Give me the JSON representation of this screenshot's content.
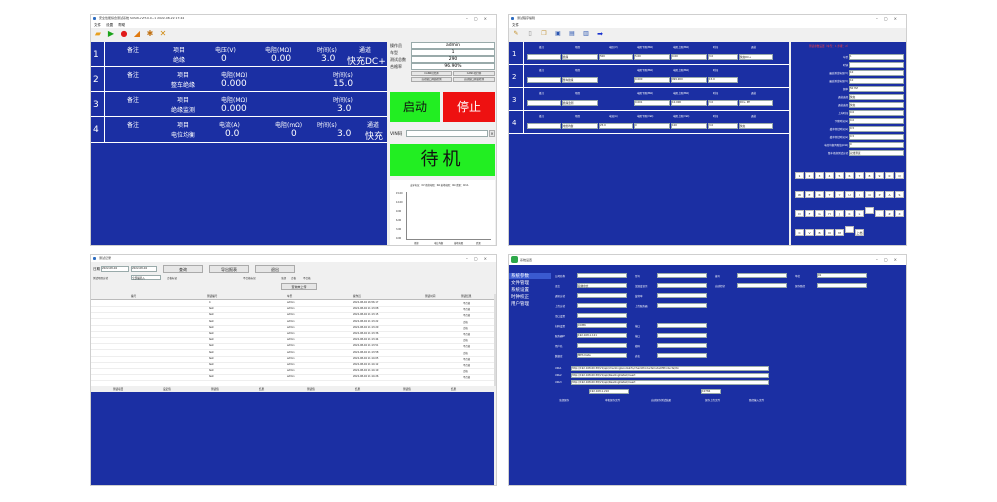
{
  "w1": {
    "title": "安全性能综合测试系统 SUSW+VIT-0.0~1 2022-08-22 17:44",
    "menu": [
      "文件",
      "设置",
      "帮助"
    ],
    "toolbar_icons": [
      "folder-open-icon",
      "play-icon",
      "stop-icon",
      "import-icon",
      "gear-icon",
      "tools-icon"
    ],
    "rows": [
      {
        "num": "1",
        "h": [
          "备注",
          "项目",
          "电压(V)",
          "电阻(MΩ)",
          "时间(s)",
          "通道"
        ],
        "v": [
          "",
          "绝缘",
          "0",
          "0.00",
          "3.0",
          "快充DC+"
        ]
      },
      {
        "num": "2",
        "h": [
          "备注",
          "项目",
          "电阻(MΩ)",
          "",
          "时间(s)",
          ""
        ],
        "v": [
          "",
          "整车绝缘",
          "0.000",
          "",
          "15.0",
          ""
        ]
      },
      {
        "num": "3",
        "h": [
          "备注",
          "项目",
          "电阻(MΩ)",
          "",
          "时间(s)",
          ""
        ],
        "v": [
          "",
          "绝缘监测",
          "0.000",
          "",
          "3.0",
          ""
        ]
      },
      {
        "num": "4",
        "h": [
          "备注",
          "项目",
          "电流(A)",
          "电阻(mΩ)",
          "时间(s)",
          "通道"
        ],
        "v": [
          "",
          "电位均衡",
          "0.0",
          "0",
          "3.0",
          "快充"
        ]
      }
    ],
    "info": [
      {
        "k": "操作员",
        "v": "admin"
      },
      {
        "k": "车型",
        "v": "1"
      },
      {
        "k": "测试总数",
        "v": "290"
      },
      {
        "k": "合格率",
        "v": "96.90%"
      }
    ],
    "can_labels": [
      "CAN0已打开",
      "CAN1已打开",
      "自动窗口开始检测",
      "自动窗口开始检测"
    ],
    "start_label": "启动",
    "stop_label": "停止",
    "vin_label": "VIN码",
    "status_label": "待机",
    "chart_legend": "击穿电压：0V  绝缘电阻：0Ω  接地电阻：0Ω  泄漏：0mA",
    "chart_yticks": [
      "15.00",
      "12.00",
      "9.00",
      "6.00",
      "3.00",
      "0.00"
    ],
    "chart_xticks": [
      "绝缘",
      "电位均衡",
      "接地电阻",
      "泄漏"
    ]
  },
  "w2": {
    "title": "测试程序编辑",
    "menu": [
      "文件"
    ],
    "toolbar_icons": [
      "pencil-icon",
      "new-icon",
      "copy-icon",
      "save-icon",
      "save-as-icon",
      "export-icon",
      "arrow-right-icon"
    ],
    "rows": [
      {
        "num": "1",
        "h": [
          "备注",
          "项目",
          "电压(V)",
          "电阻下限(MΩ)",
          "电阻上限(MΩ)",
          "时间",
          "通道"
        ],
        "v": [
          "",
          "绝缘",
          "500",
          "5.00",
          "0.00",
          "3.0",
          "快充DC+"
        ]
      },
      {
        "num": "2",
        "h": [
          "备注",
          "项目",
          "",
          "电阻下限(MΩ)",
          "电阻上限(MΩ)",
          "时间",
          ""
        ],
        "v": [
          "",
          "整车绝缘",
          "",
          "0.000",
          "999.900",
          "15.0",
          ""
        ]
      },
      {
        "num": "3",
        "h": [
          "备注",
          "项目",
          "",
          "电阻下限(MΩ)",
          "电阻上限(MΩ)",
          "时间",
          "通道"
        ],
        "v": [
          "",
          "绝缘监测",
          "",
          "0.001",
          "10.000",
          "3.0",
          "DC+ PE"
        ]
      },
      {
        "num": "4",
        "h": [
          "备注",
          "项目",
          "电流(A)",
          "电阻下限(mΩ)",
          "电阻上限(mΩ)",
          "时间",
          "通道"
        ],
        "v": [
          "",
          "电位均衡",
          "25.0",
          "0",
          "100",
          "3.0",
          "快充"
        ]
      }
    ],
    "side_header": "测试参数设置（车型：1 步骤：2）",
    "side_fields": [
      {
        "k": "车型",
        "v": "1"
      },
      {
        "k": "时钟",
        "v": ""
      },
      {
        "k": "最高测试电压(V)",
        "v": "10"
      },
      {
        "k": "最高测试电压(V)",
        "v": "10"
      },
      {
        "k": "频率",
        "v": "50 HZ"
      },
      {
        "k": "通道选择",
        "v": "快充"
      },
      {
        "k": "通道选择",
        "v": "快充"
      },
      {
        "k": "上升时间",
        "v": "0.0"
      },
      {
        "k": "下降时间(s)",
        "v": "0.0"
      },
      {
        "k": "缓冲测试时间(s)",
        "v": "0.5"
      },
      {
        "k": "缓冲测试时间(s)",
        "v": "0.5"
      },
      {
        "k": "电位均衡判断值(mΩ)",
        "v": "0"
      },
      {
        "k": "整车绝缘测试方式",
        "v": "双线测试"
      }
    ],
    "keypad": [
      "1",
      "2",
      "3",
      "4",
      "5",
      "6",
      "7",
      "8",
      "9",
      "0",
      "Q",
      "W",
      "E",
      "R",
      "T",
      "Y",
      "U",
      "I",
      "O",
      "P",
      "A",
      "S",
      "D",
      "F",
      "G",
      "H",
      "J",
      "K",
      "L",
      "",
      ".",
      "Z",
      "X",
      "C",
      "V",
      "B",
      "N",
      "M",
      "",
      "上档"
    ]
  },
  "w3": {
    "title": "测试记录",
    "date_label": "日期",
    "date_from": "2022-08-04",
    "date_to": "2022-08-04",
    "query_label": "查询",
    "export_label": "导出报表",
    "exit_label": "退出",
    "filters": [
      "测试项目方式",
      "全部编码入",
      "合格标记",
      "不合格标记",
      "全部",
      "合格",
      "不合格"
    ],
    "upload_label": "查询未上传",
    "columns": [
      "编号",
      "测试编号",
      "车型",
      "操作员",
      "测试时间",
      "测试结果"
    ],
    "records": [
      {
        "no": "",
        "vin": "4",
        "model": "",
        "op": "admin",
        "time": "2022-08-04 16:56:17",
        "result": "不合格"
      },
      {
        "no": "",
        "vin": "test",
        "model": "",
        "op": "admin",
        "time": "2022-08-04 11:13:08",
        "result": "不合格"
      },
      {
        "no": "",
        "vin": "test",
        "model": "",
        "op": "admin",
        "time": "2022-08-04 11:13:15",
        "result": "不合格"
      },
      {
        "no": "",
        "vin": "test",
        "model": "",
        "op": "admin",
        "time": "2022-08-04 11:13:22",
        "result": "合格"
      },
      {
        "no": "",
        "vin": "test",
        "model": "",
        "op": "admin",
        "time": "2022-08-04 11:13:29",
        "result": "合格"
      },
      {
        "no": "",
        "vin": "test",
        "model": "",
        "op": "admin",
        "time": "2022-08-04 11:13:36",
        "result": "不合格"
      },
      {
        "no": "",
        "vin": "test",
        "model": "",
        "op": "admin",
        "time": "2022-08-04 11:13:44",
        "result": "合格"
      },
      {
        "no": "",
        "vin": "test",
        "model": "",
        "op": "admin",
        "time": "2022-08-04 11:13:51",
        "result": "不合格"
      },
      {
        "no": "",
        "vin": "test",
        "model": "",
        "op": "admin",
        "time": "2022-08-04 11:13:58",
        "result": "合格"
      },
      {
        "no": "",
        "vin": "test",
        "model": "",
        "op": "admin",
        "time": "2022-08-04 11:14:05",
        "result": "不合格"
      },
      {
        "no": "",
        "vin": "test",
        "model": "",
        "op": "admin",
        "time": "2022-08-04 11:14:12",
        "result": "不合格"
      },
      {
        "no": "",
        "vin": "test",
        "model": "",
        "op": "admin",
        "time": "2022-08-04 11:14:19",
        "result": "合格"
      },
      {
        "no": "",
        "vin": "test",
        "model": "",
        "op": "admin",
        "time": "2022-08-04 11:14:26",
        "result": "不合格"
      }
    ],
    "detail_columns": [
      "测试项目",
      "设定值",
      "测试值",
      "结果",
      "测试值",
      "结果",
      "测试值",
      "结果"
    ]
  },
  "w4": {
    "title": "系统设置",
    "nav": [
      "系统参数",
      "文件管理",
      "系统设置",
      "时钟校正",
      "用户管理"
    ],
    "rows": [
      {
        "labels": [
          "公司名称",
          "型号",
          "编号",
          "单位"
        ],
        "values": [
          "",
          "",
          "",
          "01"
        ]
      },
      {
        "labels": [
          "语言",
          "温湿度显示",
          "自动打印",
          "保存路径"
        ],
        "values": [
          "简体中文",
          "",
          "",
          ""
        ]
      },
      {
        "labels": [
          "通讯方式",
          "波特率"
        ],
        "values": [
          "",
          ""
        ]
      },
      {
        "labels": [
          "上传方式",
          "上传服务器"
        ],
        "values": [
          "",
          ""
        ]
      },
      {
        "labels": [
          "串口设置"
        ],
        "values": [
          ""
        ]
      },
      {
        "labels": [
          "扫码设置",
          "端口"
        ],
        "values": [
          "COM6",
          ""
        ]
      },
      {
        "labels": [
          "服务器IP",
          "端口"
        ],
        "values": [
          "192.168.1.121",
          ""
        ]
      },
      {
        "labels": [
          "用户名",
          "密码"
        ],
        "values": [
          "",
          ""
        ]
      },
      {
        "labels": [
          "数据库",
          "表名"
        ],
        "values": [
          "MES Data",
          ""
        ]
      }
    ],
    "urls": [
      "http://192.168.60.58/V1/api/checkingGoodsInfo/checkProductsCodeOfProducts/Vin",
      "http://192.168.60.58/V1/api/ReadingDetail/Insert",
      "http://192.168.60.58/V1/api/ReadingDetail/Insert"
    ],
    "footer": [
      "全部保存",
      "本机保存文件",
      "自动保存测试结果",
      "保存上传文件",
      "路径输入文件"
    ],
    "host_ip": "192.168.1.210",
    "port": "10784"
  }
}
